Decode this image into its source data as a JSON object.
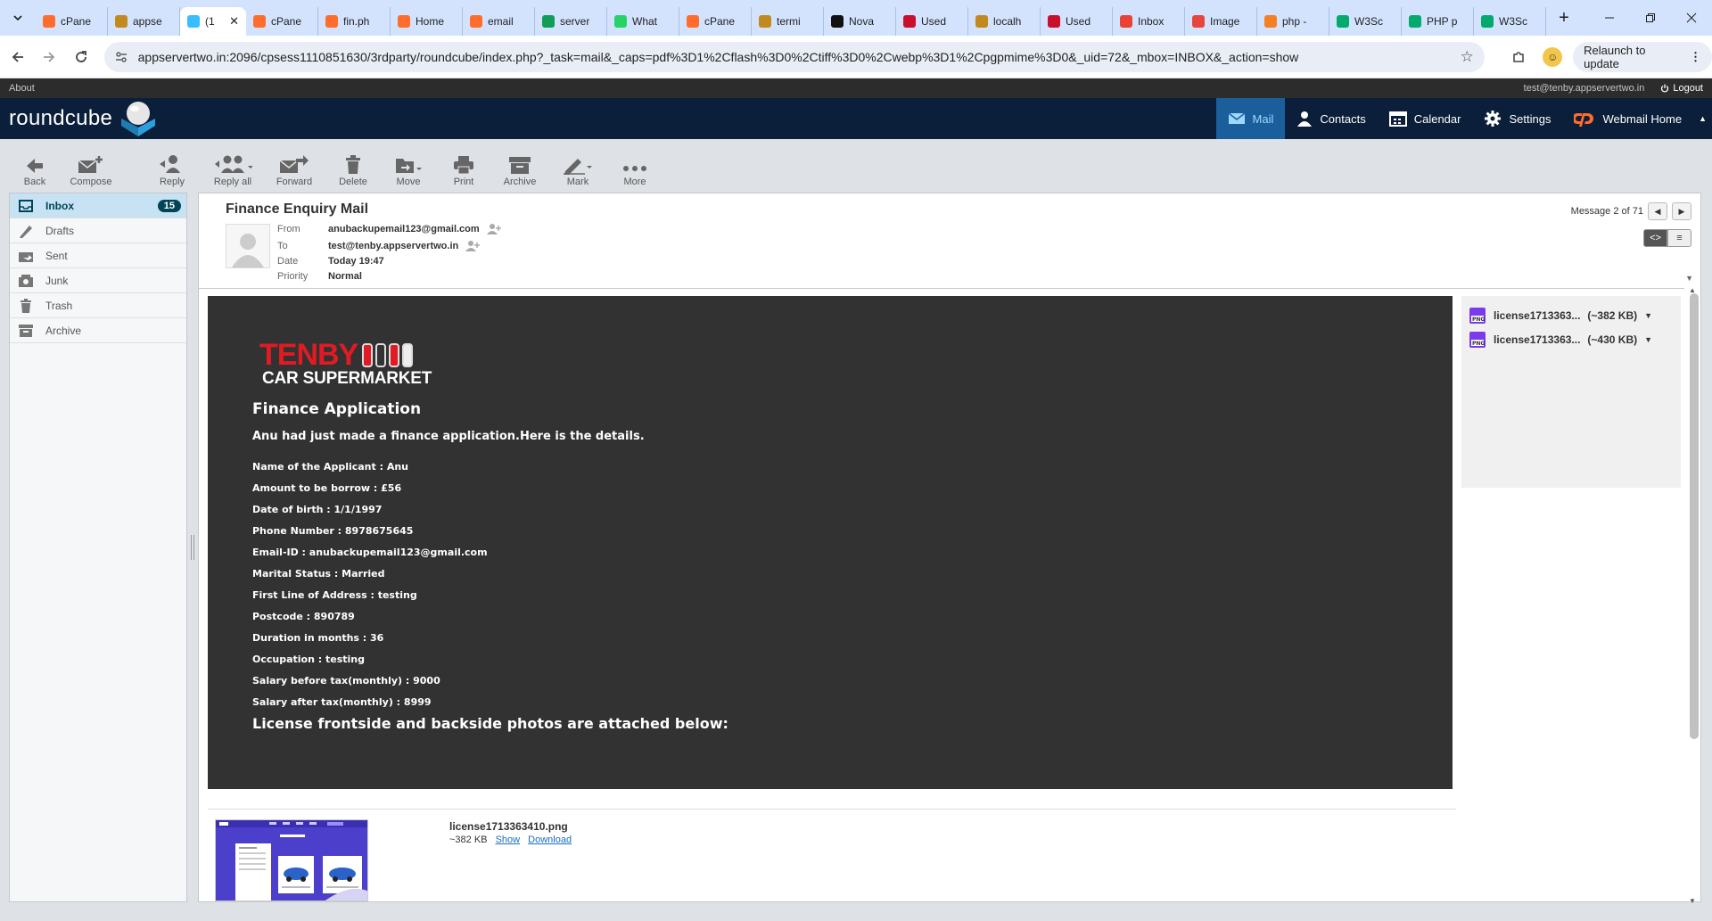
{
  "browser": {
    "tabs": [
      {
        "label": "cPane",
        "icon": "cpanel-icon",
        "color": "#ff6c2c"
      },
      {
        "label": "appse",
        "icon": "server-icon",
        "color": "#c28a1e"
      },
      {
        "label": "(1",
        "icon": "roundcube-icon",
        "color": "#37beff",
        "active": true
      },
      {
        "label": "cPane",
        "icon": "cpanel-icon",
        "color": "#ff6c2c"
      },
      {
        "label": "fin.ph",
        "icon": "cpanel-icon",
        "color": "#ff6c2c"
      },
      {
        "label": "Home",
        "icon": "cpanel-icon",
        "color": "#ff6c2c"
      },
      {
        "label": "email",
        "icon": "cpanel-icon",
        "color": "#ff6c2c"
      },
      {
        "label": "server",
        "icon": "sheets-icon",
        "color": "#0f9d58"
      },
      {
        "label": "What",
        "icon": "whatsapp-icon",
        "color": "#25d366"
      },
      {
        "label": "cPane",
        "icon": "cpanel-icon",
        "color": "#ff6c2c"
      },
      {
        "label": "termi",
        "icon": "server-icon",
        "color": "#c28a1e"
      },
      {
        "label": "Nova",
        "icon": "notion-icon",
        "color": "#111111"
      },
      {
        "label": "Used",
        "icon": "used-icon",
        "color": "#c8102e"
      },
      {
        "label": "localh",
        "icon": "server-icon",
        "color": "#c28a1e"
      },
      {
        "label": "Used",
        "icon": "used-icon",
        "color": "#c8102e"
      },
      {
        "label": "Inbox",
        "icon": "gmail-icon",
        "color": "#ea4335"
      },
      {
        "label": "Image",
        "icon": "fire-icon",
        "color": "#e8453c"
      },
      {
        "label": "php -",
        "icon": "php-icon",
        "color": "#f48024"
      },
      {
        "label": "W3Sc",
        "icon": "w3-icon",
        "color": "#04aa6d"
      },
      {
        "label": "PHP p",
        "icon": "w3-icon",
        "color": "#04aa6d"
      },
      {
        "label": "W3Sc",
        "icon": "w3-icon",
        "color": "#04aa6d"
      }
    ],
    "url": "appservertwo.in:2096/cpsess1110851630/3rdparty/roundcube/index.php?_task=mail&_caps=pdf%3D1%2Cflash%3D0%2Ctiff%3D0%2Cwebp%3D1%2Cpgpmime%3D0&_uid=72&_mbox=INBOX&_action=show",
    "relaunch_label": "Relaunch to update"
  },
  "topline": {
    "about": "About",
    "user": "test@tenby.appservertwo.in",
    "logout": "Logout"
  },
  "header": {
    "logo": "roundcube",
    "tasks": [
      {
        "label": "Mail",
        "icon": "mail-icon",
        "selected": true
      },
      {
        "label": "Contacts",
        "icon": "contacts-icon"
      },
      {
        "label": "Calendar",
        "icon": "calendar-icon"
      },
      {
        "label": "Settings",
        "icon": "gear-icon"
      },
      {
        "label": "Webmail Home",
        "icon": "cpanel-icon"
      }
    ]
  },
  "toolbar": {
    "back": "Back",
    "compose": "Compose",
    "reply": "Reply",
    "reply_all": "Reply all",
    "forward": "Forward",
    "delete": "Delete",
    "move": "Move",
    "print": "Print",
    "archive": "Archive",
    "mark": "Mark",
    "more": "More"
  },
  "folders": [
    {
      "label": "Inbox",
      "icon": "inbox-icon",
      "badge": "15",
      "selected": true
    },
    {
      "label": "Drafts",
      "icon": "pencil-icon"
    },
    {
      "label": "Sent",
      "icon": "sent-icon"
    },
    {
      "label": "Junk",
      "icon": "junk-icon"
    },
    {
      "label": "Trash",
      "icon": "trash-icon"
    },
    {
      "label": "Archive",
      "icon": "archive-icon"
    }
  ],
  "message": {
    "subject": "Finance Enquiry Mail",
    "from_label": "From",
    "from": "anubackupemail123@gmail.com",
    "to_label": "To",
    "to": "test@tenby.appservertwo.in",
    "date_label": "Date",
    "date": "Today 19:47",
    "priority_label": "Priority",
    "priority": "Normal",
    "counter": "Message 2 of 71"
  },
  "body": {
    "brand_top": "TENBY",
    "brand_bottom": "CAR SUPERMARKET",
    "title": "Finance Application",
    "intro": "Anu had just made a finance application.Here is the details.",
    "details": [
      "Name of the Applicant : Anu",
      "Amount to be borrow : £56",
      "Date of birth : 1/1/1997",
      "Phone Number : 8978675645",
      "Email-ID : anubackupemail123@gmail.com",
      "Marital Status : Married",
      "First Line of Address : testing",
      "Postcode : 890789",
      "Duration in months : 36",
      "Occupation : testing",
      "Salary before tax(monthly) : 9000",
      "Salary after tax(monthly) : 8999"
    ],
    "license_note": "License frontside and backside photos are attached below:"
  },
  "attachments": [
    {
      "name": "license1713363...",
      "size": "(~382 KB)"
    },
    {
      "name": "license1713363...",
      "size": "(~430 KB)"
    }
  ],
  "preview": {
    "filename": "license1713363410.png",
    "size": "~382 KB",
    "show": "Show",
    "download": "Download"
  }
}
